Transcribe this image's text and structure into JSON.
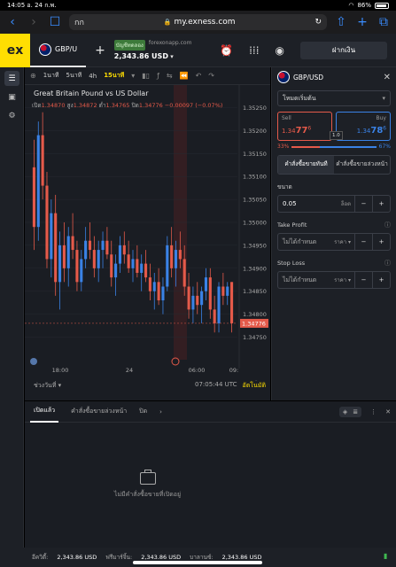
{
  "status": {
    "time": "14:05",
    "date": "อ. 24 ก.พ.",
    "battery": "86%"
  },
  "browser": {
    "aa": "กก",
    "url": "my.exness.com"
  },
  "header": {
    "logo": "ex",
    "symbol_tab": "GBP/U",
    "account_type": "บัญชีทดลอง",
    "server": "forexonapp.com",
    "balance": "2,343.86 USD",
    "deposit": "ฝากเงิน"
  },
  "chart": {
    "timeframes": [
      "1นาที",
      "5นาที",
      "4h",
      "15นาที"
    ],
    "active_timeframe": "15นาที",
    "title": "Great Britain Pound vs US Dollar",
    "ohlc": {
      "open_label": "เปิด",
      "open": "1.34870",
      "high_label": "สูง",
      "high": "1.34872",
      "low_label": "ต่ำ",
      "low": "1.34765",
      "close_label": "ปิด",
      "close": "1.34776",
      "change": "−0.00097 (−0.07%)"
    },
    "period_label": "ช่วงวันที่",
    "utc_time": "07:05:44 UTC",
    "auto_label": "อัตโนมัติ",
    "time_labels": [
      "18:00",
      "24",
      "06:00",
      "09:"
    ],
    "last_price": "1.34776"
  },
  "chart_data": {
    "type": "candlestick",
    "y_ticks": [
      1.3525,
      1.352,
      1.3515,
      1.351,
      1.3505,
      1.35,
      1.3495,
      1.349,
      1.3485,
      1.348,
      1.3475
    ],
    "ylim": [
      1.3472,
      1.3528
    ],
    "candles": [
      [
        1.3512,
        1.3518,
        1.3494,
        1.3499
      ],
      [
        1.3499,
        1.3522,
        1.3496,
        1.3519
      ],
      [
        1.3519,
        1.3524,
        1.3505,
        1.3508
      ],
      [
        1.3508,
        1.3511,
        1.349,
        1.3492
      ],
      [
        1.3492,
        1.3505,
        1.3488,
        1.3502
      ],
      [
        1.3502,
        1.3506,
        1.3484,
        1.3487
      ],
      [
        1.3487,
        1.3498,
        1.3481,
        1.3495
      ],
      [
        1.3495,
        1.35,
        1.3487,
        1.349
      ],
      [
        1.349,
        1.3499,
        1.3486,
        1.3497
      ],
      [
        1.3497,
        1.3502,
        1.3492,
        1.3494
      ],
      [
        1.3494,
        1.3496,
        1.3485,
        1.3487
      ],
      [
        1.3487,
        1.3494,
        1.3485,
        1.3492
      ],
      [
        1.3492,
        1.3499,
        1.349,
        1.3496
      ],
      [
        1.3496,
        1.35,
        1.3492,
        1.3494
      ],
      [
        1.3494,
        1.3497,
        1.3488,
        1.349
      ],
      [
        1.349,
        1.3496,
        1.3487,
        1.3494
      ],
      [
        1.3494,
        1.3498,
        1.349,
        1.3496
      ],
      [
        1.3496,
        1.3499,
        1.3492,
        1.3493
      ],
      [
        1.3493,
        1.3496,
        1.3486,
        1.3488
      ],
      [
        1.3488,
        1.3493,
        1.3484,
        1.3491
      ],
      [
        1.3491,
        1.3497,
        1.3489,
        1.3495
      ],
      [
        1.3495,
        1.3498,
        1.3491,
        1.3493
      ],
      [
        1.3493,
        1.3496,
        1.3489,
        1.349
      ],
      [
        1.349,
        1.3494,
        1.3487,
        1.3492
      ],
      [
        1.3492,
        1.3495,
        1.3488,
        1.3489
      ],
      [
        1.3489,
        1.3493,
        1.3485,
        1.3491
      ],
      [
        1.3491,
        1.3494,
        1.3487,
        1.3488
      ],
      [
        1.3488,
        1.3491,
        1.3483,
        1.3485
      ],
      [
        1.3485,
        1.3489,
        1.3481,
        1.3487
      ],
      [
        1.3487,
        1.349,
        1.3482,
        1.3483
      ],
      [
        1.3483,
        1.3488,
        1.348,
        1.3486
      ],
      [
        1.3486,
        1.3497,
        1.3485,
        1.3495
      ],
      [
        1.3495,
        1.3499,
        1.3488,
        1.349
      ],
      [
        1.349,
        1.3496,
        1.3486,
        1.3494
      ],
      [
        1.3494,
        1.3498,
        1.349,
        1.3492
      ],
      [
        1.3492,
        1.3495,
        1.3484,
        1.3486
      ],
      [
        1.3486,
        1.3489,
        1.3479,
        1.3481
      ],
      [
        1.3481,
        1.3486,
        1.3478,
        1.3484
      ],
      [
        1.3484,
        1.3487,
        1.348,
        1.3482
      ],
      [
        1.3482,
        1.3486,
        1.3478,
        1.3485
      ],
      [
        1.3485,
        1.349,
        1.3483,
        1.3488
      ],
      [
        1.3488,
        1.349,
        1.3479,
        1.3481
      ],
      [
        1.3481,
        1.3484,
        1.3476,
        1.3478
      ],
      [
        1.3478,
        1.3487,
        1.3476,
        1.3486
      ],
      [
        1.3486,
        1.3489,
        1.3482,
        1.3484
      ],
      [
        1.3484,
        1.3487,
        1.3482,
        1.3486
      ],
      [
        1.3487,
        1.3487,
        1.3476,
        1.3478
      ]
    ]
  },
  "order_panel": {
    "symbol": "GBP/USD",
    "mode": "โหมดเริ่มต้น",
    "sell_label": "Sell",
    "buy_label": "Buy",
    "sell_price_main": "1.34",
    "sell_price_big": "77",
    "sell_price_sup": "6",
    "buy_price_main": "1.34",
    "buy_price_big": "78",
    "buy_price_sup": "6",
    "spread": "1.0",
    "sell_pct": "33%",
    "buy_pct": "67%",
    "tab_market": "คำสั่งซื้อขายทันที",
    "tab_pending": "คำสั่งซื้อขายล่วงหน้า",
    "volume_label": "ขนาด",
    "volume": "0.05",
    "volume_unit": "ล็อต",
    "tp_label": "Take Profit",
    "tp_value": "ไม่ได้กำหนด",
    "tp_unit": "ราคา",
    "sl_label": "Stop Loss",
    "sl_value": "ไม่ได้กำหนด",
    "sl_unit": "ราคา"
  },
  "orders": {
    "tab_open": "เปิดแล้ว",
    "tab_pending": "คำสั่งซื้อขายล่วงหน้า",
    "tab_closed": "ปิด",
    "empty_text": "ไม่มีคำสั่งซื้อขายที่เปิดอยู่"
  },
  "footer": {
    "equity_label": "อีควิตี้:",
    "equity": "2,343.86 USD",
    "free_margin_label": "ฟรีมาร์จิ้น:",
    "free_margin": "2,343.86 USD",
    "balance_label": "บาลานซ์:",
    "balance": "2,343.86 USD"
  }
}
